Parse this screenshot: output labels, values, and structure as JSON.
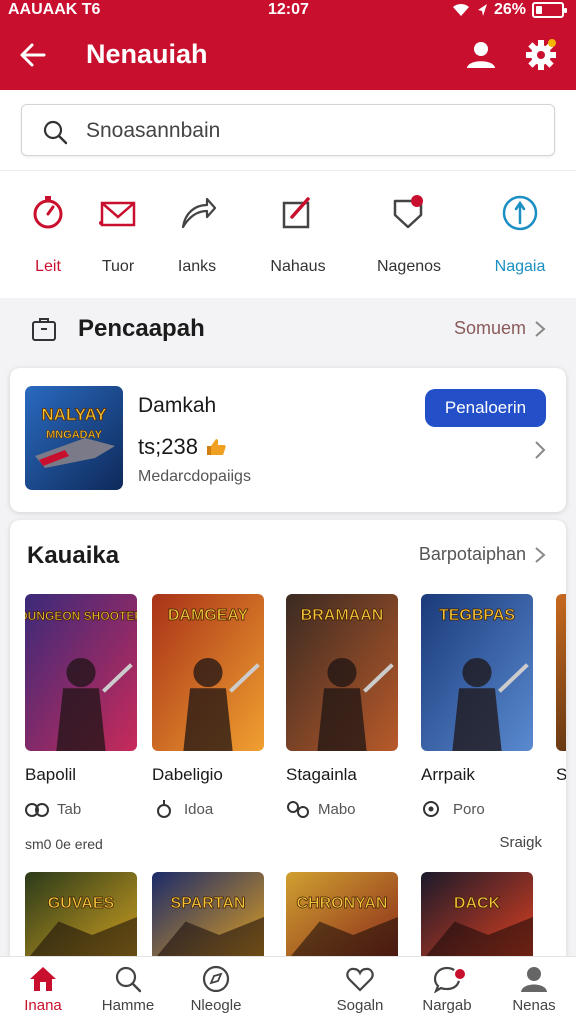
{
  "status_bar": {
    "carrier": "AAUAAK T6",
    "time": "12:07",
    "battery": "26%",
    "battery_level": 0.26
  },
  "header": {
    "title": "Nenauiah"
  },
  "search": {
    "placeholder": "Snoasannbain"
  },
  "quick_links": [
    {
      "label": "Leit",
      "icon": "timer-icon",
      "color": "#c8102e"
    },
    {
      "label": "Tuor",
      "icon": "mail-icon",
      "color": "#333333"
    },
    {
      "label": "Ianks",
      "icon": "share-arrow-icon",
      "color": "#333333"
    },
    {
      "label": "Nahaus",
      "icon": "edit-icon",
      "color": "#333333"
    },
    {
      "label": "Nagenos",
      "icon": "tag-icon",
      "color": "#333333"
    },
    {
      "label": "Nagaia",
      "icon": "compass-icon",
      "color": "#1b8fc4"
    }
  ],
  "achievement": {
    "title": "Pencaapah",
    "link": "Somuem",
    "card": {
      "title": "Damkah",
      "score": "ts;238",
      "subtitle": "Medarcdopaiigs",
      "button": "Penaloerin",
      "thumb_text": "NALYAY MNGADAY"
    }
  },
  "catalog": {
    "title": "Kauaika",
    "link": "Barpotaiphan",
    "games": [
      {
        "name": "Bapolil",
        "meta": "Tab",
        "meta_icon": "controller-icon",
        "cover_text": "DUNGEON SHOOTER",
        "colors": [
          "#3a2a7a",
          "#c82a5a"
        ]
      },
      {
        "name": "Dabeligio",
        "meta": "Idoa",
        "meta_icon": "joystick-icon",
        "cover_text": "DAMGEAY",
        "colors": [
          "#a83218",
          "#f0a030"
        ]
      },
      {
        "name": "Stagainla",
        "meta": "Mabo",
        "meta_icon": "gamepad-icon",
        "cover_text": "BRAMAAN",
        "colors": [
          "#3a2a22",
          "#b85a2a"
        ]
      },
      {
        "name": "Arrpaik",
        "meta": "Poro",
        "meta_icon": "console-icon",
        "cover_text": "TEGBPAS",
        "colors": [
          "#1a3a7a",
          "#5a8ad0"
        ]
      }
    ],
    "partial_label": "S",
    "footer_left": "sm0 0e ered",
    "footer_right": "Sraigk",
    "second_row": [
      {
        "cover_text": "GUVAES",
        "colors": [
          "#2a3a1a",
          "#d0a020"
        ]
      },
      {
        "cover_text": "SPARTAN",
        "colors": [
          "#1a2a6a",
          "#e0a020"
        ]
      },
      {
        "cover_text": "CHRONYAN",
        "colors": [
          "#d0a030",
          "#8a2a1a"
        ]
      },
      {
        "cover_text": "DACK",
        "colors": [
          "#1a1a2a",
          "#e04020"
        ]
      }
    ]
  },
  "bottom_nav": [
    {
      "label": "Inana",
      "icon": "home-icon",
      "active": true
    },
    {
      "label": "Hamme",
      "icon": "search-icon",
      "active": false
    },
    {
      "label": "Nleogle",
      "icon": "compass-icon",
      "active": false
    },
    {
      "label": "Sogaln",
      "icon": "heart-icon",
      "active": false
    },
    {
      "label": "Nargab",
      "icon": "chat-icon",
      "active": false,
      "badge": true
    },
    {
      "label": "Nenas",
      "icon": "profile-icon",
      "active": false
    }
  ],
  "colors": {
    "brand": "#c8102e",
    "primary_button": "#2350c9",
    "accent_link": "#1b8fc4"
  }
}
